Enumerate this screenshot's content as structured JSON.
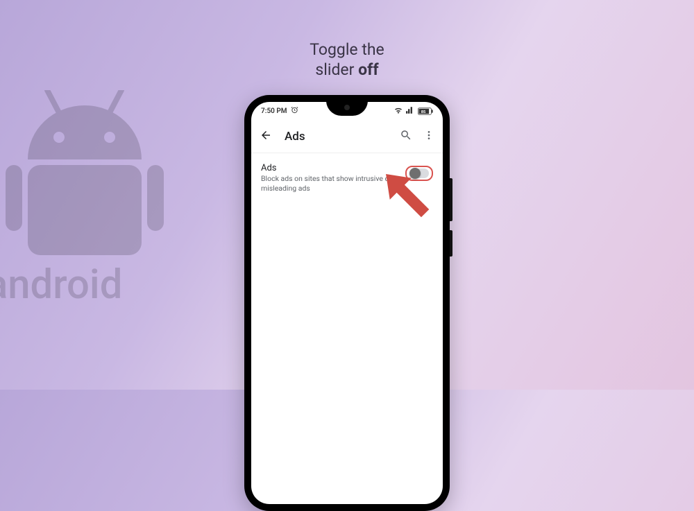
{
  "instruction": {
    "line1": "Toggle the",
    "line2_plain": "slider ",
    "line2_bold": "off"
  },
  "status_bar": {
    "time": "7:50 PM",
    "battery_text": "85"
  },
  "header": {
    "title": "Ads"
  },
  "setting": {
    "title": "Ads",
    "desc": "Block ads on sites that show intrusive or misleading ads"
  },
  "watermark_text": "android"
}
